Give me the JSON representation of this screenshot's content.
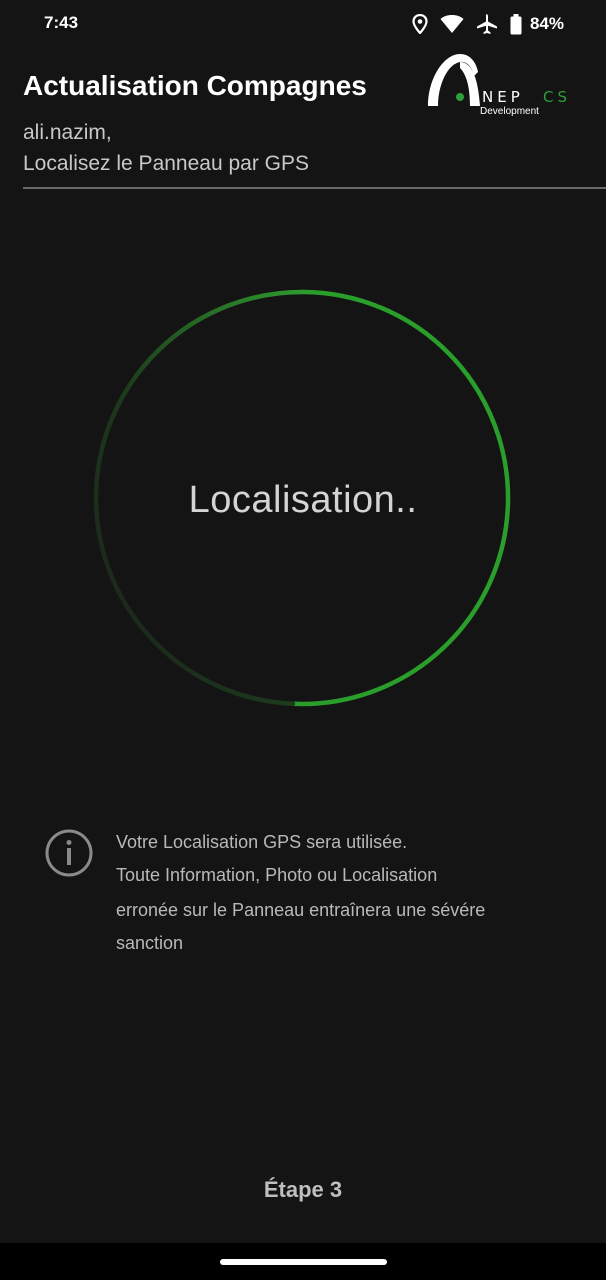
{
  "status_bar": {
    "time": "7:43",
    "battery_percent": "84%",
    "icons": [
      "location-icon",
      "wifi-icon",
      "airplane-mode-icon",
      "battery-icon"
    ]
  },
  "header": {
    "title": "Actualisation Compagnes",
    "user_name": "ali.nazim,",
    "instruction": "Localisez le Panneau par GPS"
  },
  "logo": {
    "name_white": "NEP",
    "name_green": "CS",
    "subtitle": "Development"
  },
  "progress": {
    "label": "Localisation..",
    "accent_color": "#2e9e2e"
  },
  "notice": {
    "icon": "info-icon",
    "lines": [
      "Votre Localisation GPS sera utilisée.",
      "Toute Information, Photo ou Localisation",
      "erronée sur le Panneau entraînera une sévére",
      "sanction"
    ]
  },
  "footer": {
    "step": "Étape 3"
  },
  "colors": {
    "background": "#141414",
    "accent_green": "#2e9e2e",
    "text_primary": "#ffffff",
    "text_secondary": "#c8c8c8"
  }
}
